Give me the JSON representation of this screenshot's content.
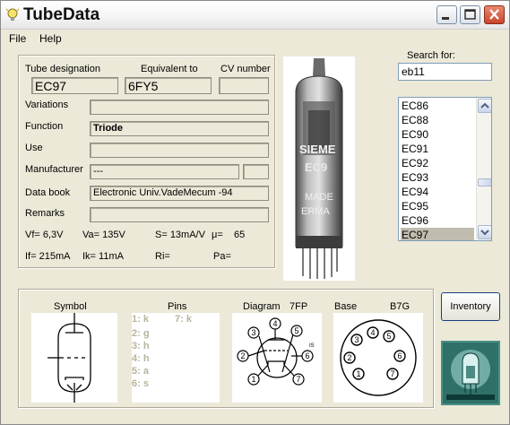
{
  "window": {
    "title": "TubeData"
  },
  "menu": {
    "file": "File",
    "help": "Help"
  },
  "search": {
    "label": "Search for:",
    "value": "eb11"
  },
  "tube_list": {
    "items": [
      "EC86",
      "EC88",
      "EC90",
      "EC91",
      "EC92",
      "EC93",
      "EC94",
      "EC95",
      "EC96",
      "EC97"
    ],
    "selected": "EC97"
  },
  "labels": {
    "designation": "Tube designation",
    "equivalent": "Equivalent to",
    "cv_number": "CV number",
    "variations": "Variations",
    "function": "Function",
    "use": "Use",
    "manufacturer": "Manufacturer",
    "data_book": "Data book",
    "remarks": "Remarks"
  },
  "values": {
    "designation": "EC97",
    "equivalent": "6FY5",
    "cv_number": "",
    "variations": "",
    "function": "Triode",
    "use": "",
    "manufacturer": "---",
    "manufacturer_code": "",
    "data_book": "Electronic Univ.VadeMecum -94",
    "remarks": ""
  },
  "specs": {
    "vf": "Vf= 6,3V",
    "va": "Va= 135V",
    "s": "S= 13mA/V",
    "mu_label": "μ=",
    "mu": "65",
    "if": "If= 215mA",
    "ik": "Ik= 11mA",
    "ri": "Ri=",
    "pa": "Pa="
  },
  "bottom": {
    "symbol_label": "Symbol",
    "pins_label": "Pins",
    "diagram_label": "Diagram",
    "diagram_code": "7FP",
    "base_label": "Base",
    "base_code": "B7G",
    "pins": [
      "1: k",
      "7: k",
      "2: g",
      "3: h",
      "4: h",
      "5: a",
      "6: s"
    ]
  },
  "photo_text": [
    "SIEME",
    "EC9",
    "MADE",
    "ERMA"
  ],
  "inventory_button": "Inventory"
}
